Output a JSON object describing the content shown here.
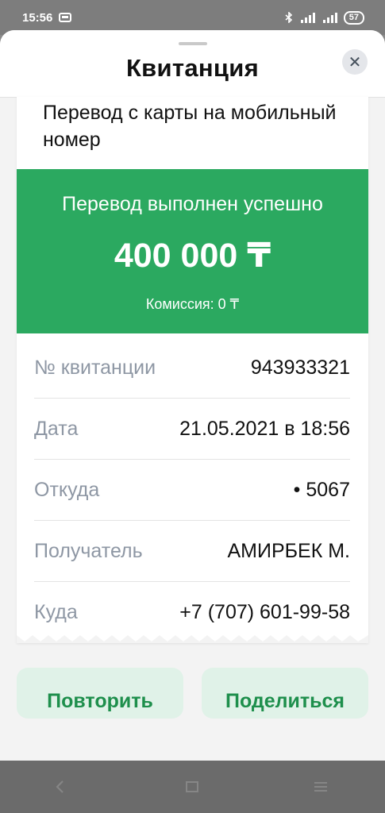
{
  "status_bar": {
    "time": "15:56",
    "network": "R 4G",
    "battery": "57"
  },
  "sheet": {
    "title": "Квитанция",
    "close_icon": "close-icon",
    "close_glyph": "✕"
  },
  "receipt": {
    "subtitle": "Перевод с карты на мобильный номер",
    "success": {
      "title": "Перевод выполнен успешно",
      "amount": "400 000 ₸",
      "fee": "Комиссия: 0 ₸"
    },
    "rows": [
      {
        "label": "№ квитанции",
        "value": "943933321"
      },
      {
        "label": "Дата",
        "value": "21.05.2021 в 18:56"
      },
      {
        "label": "Откуда",
        "value": "• 5067"
      },
      {
        "label": "Получатель",
        "value": "АМИРБЕК М."
      },
      {
        "label": "Куда",
        "value": "+7 (707) 601-99-58"
      }
    ]
  },
  "actions": {
    "repeat_label": "Повторить",
    "share_label": "Поделиться"
  },
  "colors": {
    "success_green": "#2ba960",
    "action_bg": "#e0f2e8",
    "action_text": "#1e8f4c",
    "label_gray": "#8e97a4"
  }
}
